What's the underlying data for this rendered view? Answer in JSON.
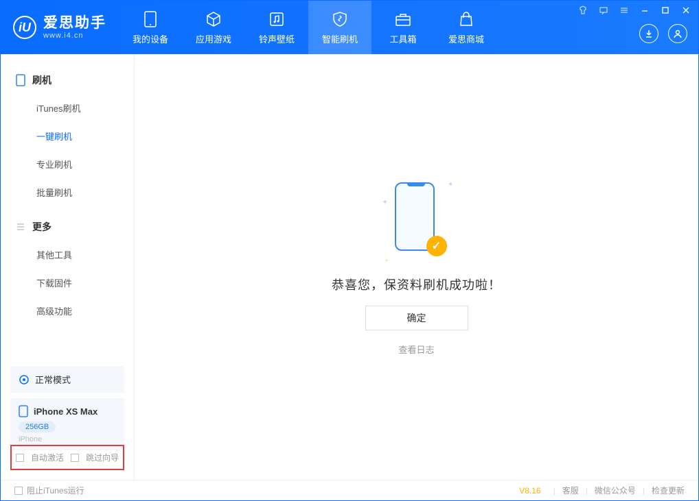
{
  "app": {
    "name": "爱思助手",
    "url": "www.i4.cn"
  },
  "nav": [
    {
      "label": "我的设备"
    },
    {
      "label": "应用游戏"
    },
    {
      "label": "铃声壁纸"
    },
    {
      "label": "智能刷机",
      "active": true
    },
    {
      "label": "工具箱"
    },
    {
      "label": "爱思商城"
    }
  ],
  "sidebar": {
    "section1": {
      "title": "刷机",
      "items": [
        "iTunes刷机",
        "一键刷机",
        "专业刷机",
        "批量刷机"
      ],
      "activeIndex": 1
    },
    "section2": {
      "title": "更多",
      "items": [
        "其他工具",
        "下载固件",
        "高级功能"
      ]
    },
    "mode": "正常模式",
    "device": {
      "name": "iPhone XS Max",
      "capacity": "256GB",
      "type": "iPhone"
    },
    "checks": {
      "auto_activate": "自动激活",
      "skip_guide": "跳过向导"
    }
  },
  "main": {
    "success": "恭喜您，保资料刷机成功啦！",
    "ok": "确定",
    "log": "查看日志"
  },
  "footer": {
    "stop_itunes": "阻止iTunes运行",
    "version": "V8.16",
    "links": [
      "客服",
      "微信公众号",
      "检查更新"
    ]
  }
}
